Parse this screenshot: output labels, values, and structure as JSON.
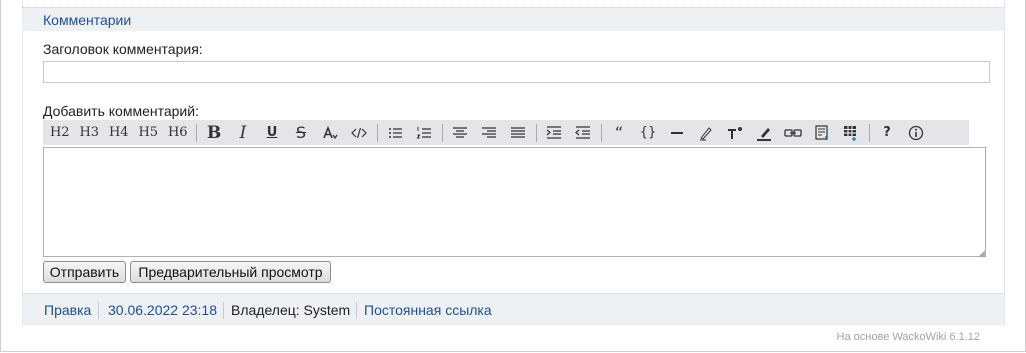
{
  "comments": {
    "section_title": "Комментарии",
    "title_label": "Заголовок комментария:",
    "title_value": "",
    "add_label": "Добавить комментарий:",
    "body_value": "",
    "submit_label": "Отправить",
    "preview_label": "Предварительный просмотр"
  },
  "toolbar": {
    "h2": "H2",
    "h3": "H3",
    "h4": "H4",
    "h5": "H5",
    "h6": "H6",
    "bold": "B",
    "italic": "I",
    "underline": "U",
    "strike": "S",
    "quote": "“",
    "braces": "{}",
    "help": "?"
  },
  "footer": {
    "edit_link": "Правка",
    "timestamp": "30.06.2022 23:18",
    "owner": "Владелец: System",
    "permalink": "Постоянная ссылка"
  },
  "powered_by": "На основе WackoWiki 6.1.12"
}
